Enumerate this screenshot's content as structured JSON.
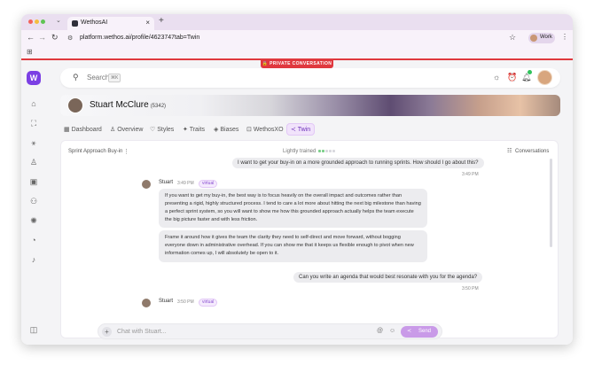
{
  "browser": {
    "tab_title": "WethosAI",
    "tab_close": "×",
    "new_tab": "+",
    "tabs_menu": "⌄",
    "url": "platform.wethos.ai/profile/4623747tab=Twin",
    "profile_label": "Work"
  },
  "banner": {
    "private": "🔒 PRIVATE CONVERSATION"
  },
  "topbar": {
    "search_placeholder": "Search",
    "search_shortcut": "⌘K"
  },
  "profile": {
    "name": "Stuart McClure",
    "id": "(5342)"
  },
  "subnav": [
    {
      "icon": "▦",
      "label": "Dashboard"
    },
    {
      "icon": "♙",
      "label": "Overview"
    },
    {
      "icon": "♡",
      "label": "Styles"
    },
    {
      "icon": "✦",
      "label": "Traits"
    },
    {
      "icon": "◈",
      "label": "Biases"
    },
    {
      "icon": "⊡",
      "label": "WethosXO"
    },
    {
      "icon": "≺",
      "label": "Twin"
    }
  ],
  "panel": {
    "title": "Sprint Approach Buy-in",
    "kebab": "⋮",
    "trained_label": "Lightly trained",
    "training_level": 0.4,
    "conversations_label": "Conversations"
  },
  "messages": {
    "user1": {
      "text": "I want to get your buy-in on a more grounded approach to running sprints. How should I go about this?",
      "time": "3:49 PM"
    },
    "ai1": {
      "name": "Stuart",
      "time": "3:49 PM",
      "badge": "virtual",
      "p1": "If you want to get my buy-in, the best way is to focus heavily on the overall impact and outcomes rather than presenting a rigid, highly structured process. I tend to care a lot more about hitting the next big milestone than having a perfect sprint system, so you will want to show me how this grounded approach actually helps the team execute the big picture faster and with less friction.",
      "p2": "Frame it around how it gives the team the clarity they need to self-direct and move forward, without bogging everyone down in administrative overhead. If you can show me that it keeps us flexible enough to pivot when new information comes up, I will absolutely be open to it."
    },
    "user2": {
      "text": "Can you write an agenda that would best resonate with you for the agenda?",
      "time": "3:50 PM"
    },
    "ai2": {
      "name": "Stuart",
      "time": "3:50 PM",
      "badge": "virtual"
    }
  },
  "composer": {
    "placeholder": "Chat with Stuart...",
    "plus": "+",
    "send_label": "Send"
  },
  "colors": {
    "accent": "#7b3fe4",
    "private_red": "#e0383e",
    "send": "#c99ae8"
  }
}
